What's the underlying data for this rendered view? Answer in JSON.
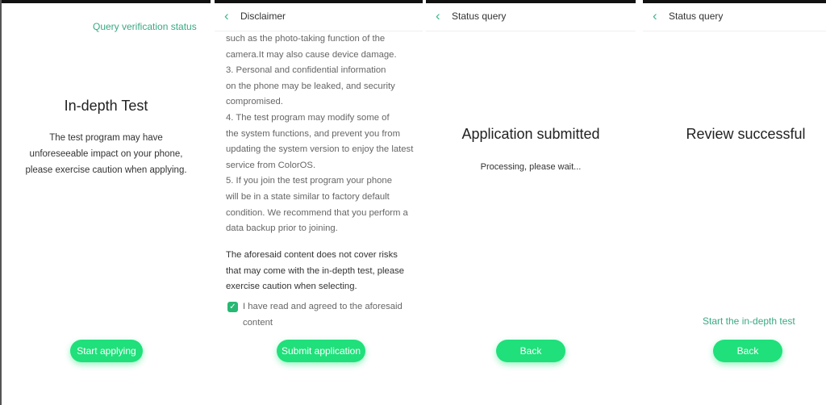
{
  "screens": [
    {
      "id": "intro",
      "link": "Query verification status",
      "title": "In-depth Test",
      "description": [
        "The test program may have",
        "unforeseeable impact on your phone,",
        "please exercise caution when applying."
      ],
      "button": "Start applying"
    },
    {
      "id": "disclaimer",
      "header_title": "Disclaimer",
      "paragraph_lines": [
        "such as the photo-taking function of the",
        "camera.It may also cause device damage.",
        "3. Personal and confidential information",
        "on the phone may be leaked, and security",
        "compromised.",
        "4. The test program may modify some of",
        "the system functions, and prevent you from",
        "updating the system version to enjoy the latest",
        "service from ColorOS.",
        "5. If you join the test program your phone",
        "will be in a state similar to factory default",
        "condition. We recommend that you perform a",
        "data backup prior to joining."
      ],
      "warning_lines": [
        "The aforesaid content does not cover risks",
        "that may come with the in-depth test, please",
        "exercise caution when selecting."
      ],
      "checkbox_checked": true,
      "checkbox_label_lines": [
        "I have read and agreed to the aforesaid",
        "content"
      ],
      "button": "Submit application"
    },
    {
      "id": "submitted",
      "header_title": "Status query",
      "title": "Application submitted",
      "status": "Processing, please wait...",
      "button": "Back"
    },
    {
      "id": "success",
      "header_title": "Status query",
      "title": "Review successful",
      "link": "Start the in-depth test",
      "button": "Back"
    }
  ],
  "icons": {
    "back": "chevron-left",
    "check": "checkmark"
  },
  "colors": {
    "accent_green": "#1fe07a",
    "link_green": "#3aa884",
    "checkbox_green": "#27b873"
  }
}
